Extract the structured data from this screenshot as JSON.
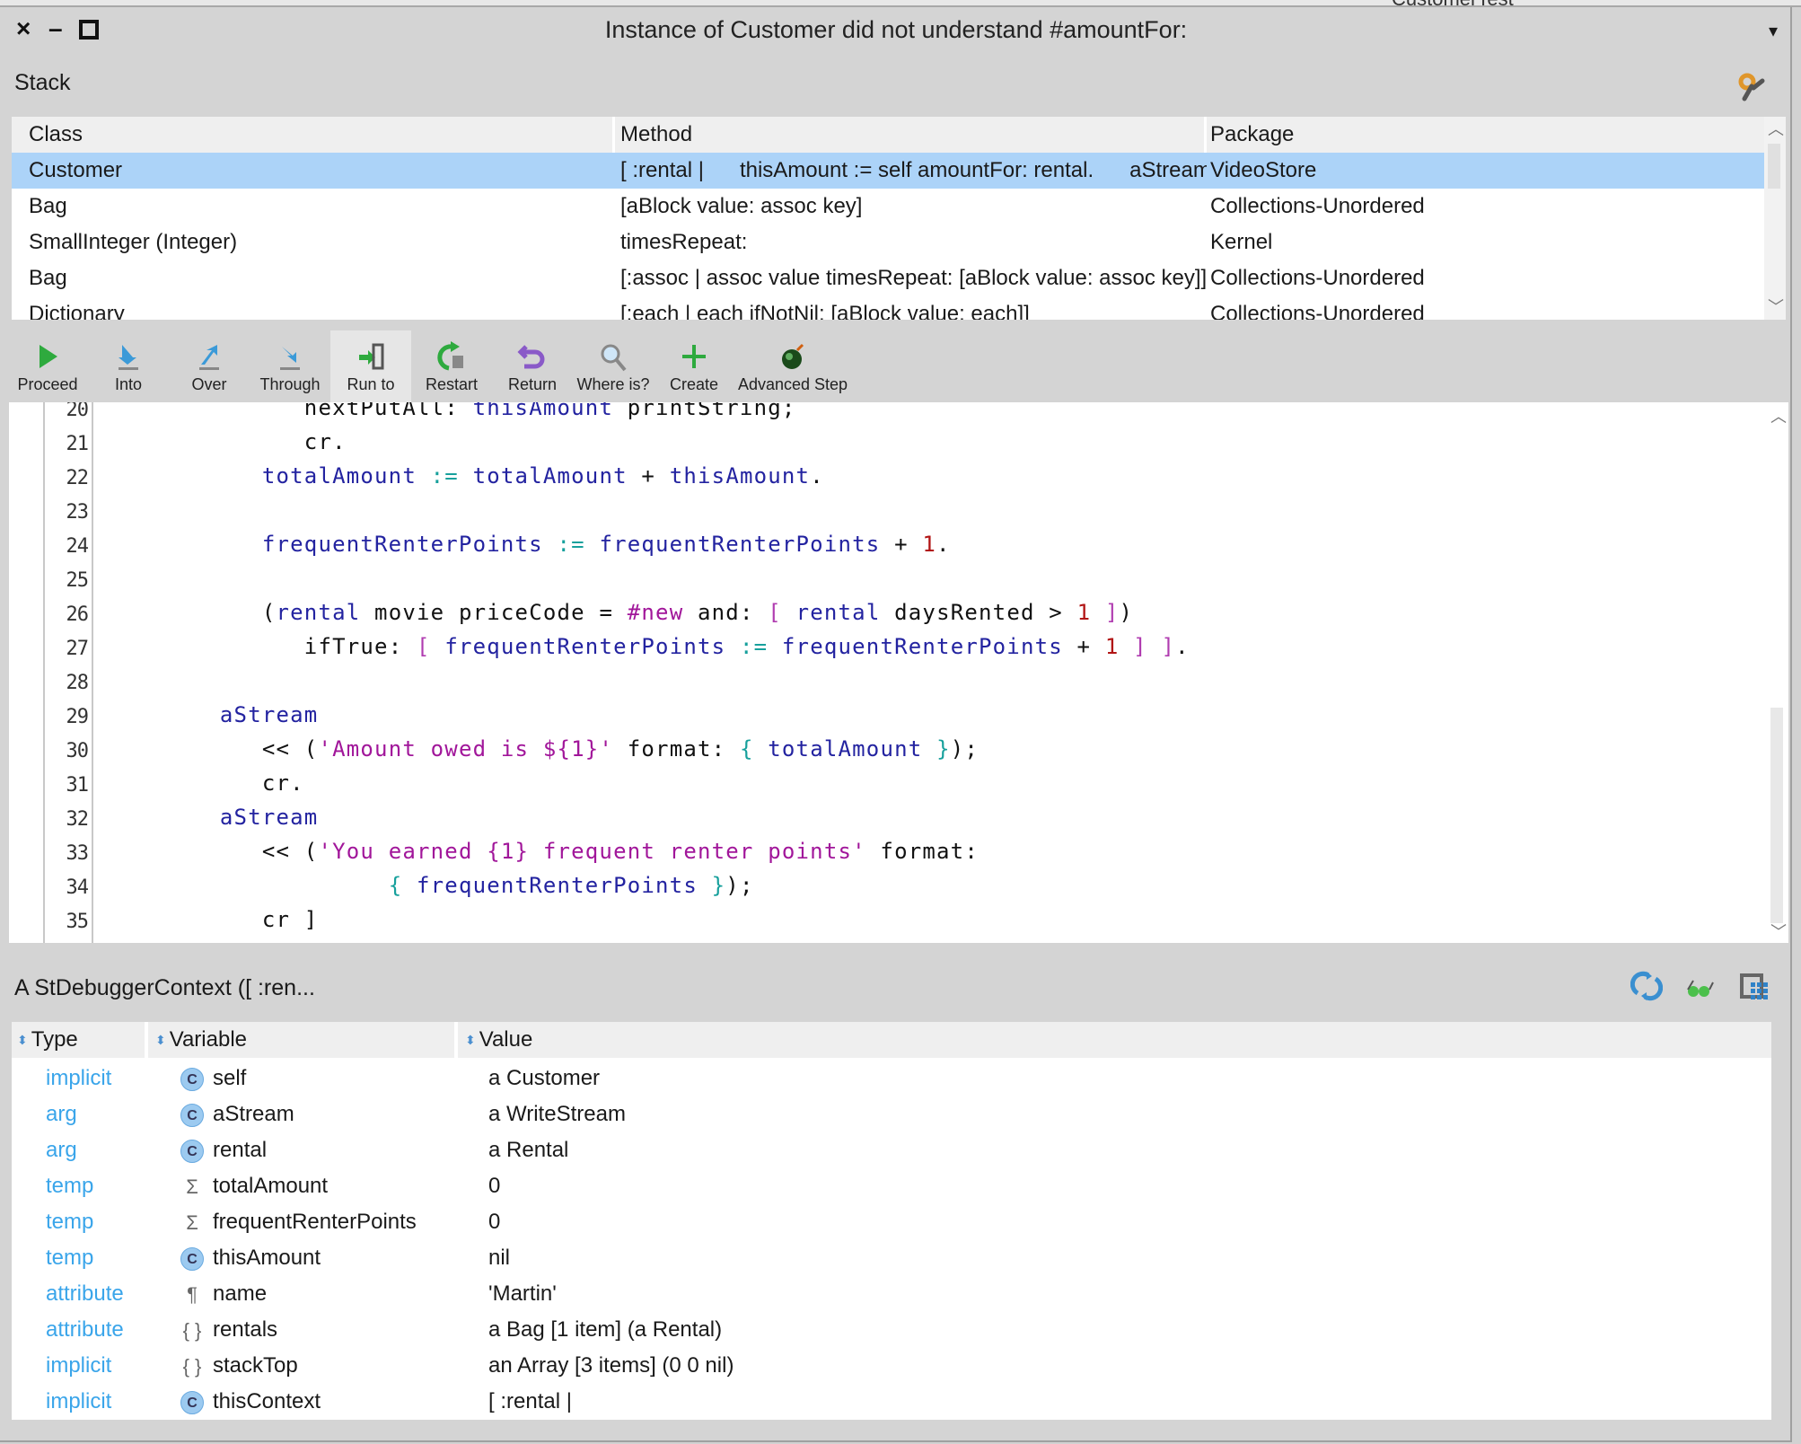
{
  "background_window": {
    "title_fragment": "CustomerTest"
  },
  "window": {
    "title": "Instance of Customer did not understand #amountFor:",
    "close": "×",
    "minimize": "–",
    "maximize": "□",
    "menu": "▾"
  },
  "stack": {
    "label": "Stack",
    "columns": [
      "Class",
      "Method",
      "Package"
    ],
    "rows": [
      {
        "class": "Customer",
        "method": "[ :rental |      thisAmount := self amountFor: rental.      aStream",
        "package": "VideoStore",
        "selected": true
      },
      {
        "class": "Bag",
        "method": "[aBlock value: assoc key]",
        "package": "Collections-Unordered"
      },
      {
        "class": "SmallInteger (Integer)",
        "method": "timesRepeat:",
        "package": "Kernel"
      },
      {
        "class": "Bag",
        "method": "[:assoc | assoc value timesRepeat: [aBlock value: assoc key]]",
        "package": "Collections-Unordered"
      },
      {
        "class": "Dictionary",
        "method": "[:each | each ifNotNil: [aBlock value: each]]",
        "package": "Collections-Unordered"
      }
    ]
  },
  "toolbar": [
    {
      "label": "Proceed",
      "icon": "play-icon"
    },
    {
      "label": "Into",
      "icon": "step-into-icon"
    },
    {
      "label": "Over",
      "icon": "step-over-icon"
    },
    {
      "label": "Through",
      "icon": "step-through-icon"
    },
    {
      "label": "Run to",
      "icon": "run-to-icon",
      "active": true
    },
    {
      "label": "Restart",
      "icon": "restart-icon"
    },
    {
      "label": "Return",
      "icon": "return-icon"
    },
    {
      "label": "Where is?",
      "icon": "magnifier-icon"
    },
    {
      "label": "Create",
      "icon": "plus-icon"
    },
    {
      "label": "Advanced Step",
      "icon": "bomb-icon"
    }
  ],
  "code": {
    "first_line": 20,
    "lines": [
      [
        [
          " ",
          "            "
        ],
        [
          "",
          "nextPutAll: "
        ],
        [
          "var",
          "thisAmount"
        ],
        [
          "",
          " printString;"
        ]
      ],
      [
        [
          " ",
          "            "
        ],
        [
          "",
          "cr."
        ]
      ],
      [
        [
          " ",
          "         "
        ],
        [
          "var",
          "totalAmount"
        ],
        [
          "tl",
          " :="
        ],
        [
          "",
          " "
        ],
        [
          "var",
          "totalAmount"
        ],
        [
          "",
          " + "
        ],
        [
          "var",
          "thisAmount"
        ],
        [
          "",
          "."
        ]
      ],
      [],
      [
        [
          " ",
          "         "
        ],
        [
          "var",
          "frequentRenterPoints"
        ],
        [
          "tl",
          " :="
        ],
        [
          "",
          " "
        ],
        [
          "var",
          "frequentRenterPoints"
        ],
        [
          "",
          " + "
        ],
        [
          "num",
          "1"
        ],
        [
          "",
          "."
        ]
      ],
      [],
      [
        [
          " ",
          "         "
        ],
        [
          "",
          "("
        ],
        [
          "var",
          "rental"
        ],
        [
          "",
          " movie priceCode = "
        ],
        [
          "sym",
          "#new"
        ],
        [
          "",
          " and: "
        ],
        [
          "br",
          "["
        ],
        [
          "",
          " "
        ],
        [
          "var",
          "rental"
        ],
        [
          "",
          " daysRented > "
        ],
        [
          "num",
          "1"
        ],
        [
          "",
          " "
        ],
        [
          "br",
          "]"
        ],
        [
          "",
          ")"
        ]
      ],
      [
        [
          " ",
          "            "
        ],
        [
          "",
          "ifTrue: "
        ],
        [
          "br",
          "["
        ],
        [
          "",
          " "
        ],
        [
          "var",
          "frequentRenterPoints"
        ],
        [
          "tl",
          " :="
        ],
        [
          "",
          " "
        ],
        [
          "var",
          "frequentRenterPoints"
        ],
        [
          "",
          " + "
        ],
        [
          "num",
          "1"
        ],
        [
          "",
          " "
        ],
        [
          "br",
          "]"
        ],
        [
          "",
          " "
        ],
        [
          "br",
          "]"
        ],
        [
          "",
          "."
        ]
      ],
      [],
      [
        [
          " ",
          "      "
        ],
        [
          "var",
          "aStream"
        ]
      ],
      [
        [
          " ",
          "         "
        ],
        [
          "",
          "<< ("
        ],
        [
          "str",
          "'Amount owed is ${1}'"
        ],
        [
          "",
          " format: "
        ],
        [
          "tl",
          "{"
        ],
        [
          "",
          " "
        ],
        [
          "var",
          "totalAmount"
        ],
        [
          "",
          " "
        ],
        [
          "tl",
          "}"
        ],
        [
          "",
          ");"
        ]
      ],
      [
        [
          " ",
          "         "
        ],
        [
          "",
          "cr."
        ]
      ],
      [
        [
          " ",
          "      "
        ],
        [
          "var",
          "aStream"
        ]
      ],
      [
        [
          " ",
          "         "
        ],
        [
          "",
          "<< ("
        ],
        [
          "str",
          "'You earned {1} frequent renter points'"
        ],
        [
          "",
          " format:"
        ]
      ],
      [
        [
          " ",
          "                  "
        ],
        [
          "tl",
          "{"
        ],
        [
          "",
          " "
        ],
        [
          "var",
          "frequentRenterPoints"
        ],
        [
          "",
          " "
        ],
        [
          "tl",
          "}"
        ],
        [
          "",
          ");"
        ]
      ],
      [
        [
          " ",
          "         "
        ],
        [
          "",
          "cr ]"
        ]
      ]
    ]
  },
  "inspector": {
    "label": "A StDebuggerContext ([ :ren...",
    "columns": [
      "Type",
      "Variable",
      "Value"
    ],
    "header_icons": [
      "refresh-icon",
      "glasses-icon",
      "grid-icon"
    ],
    "rows": [
      {
        "type": "implicit",
        "icon": "C",
        "var": "self",
        "value": "a Customer"
      },
      {
        "type": "arg",
        "icon": "C",
        "var": "aStream",
        "value": "a WriteStream"
      },
      {
        "type": "arg",
        "icon": "C",
        "var": "rental",
        "value": "a Rental"
      },
      {
        "type": "temp",
        "icon": "Σ",
        "var": "totalAmount",
        "value": "0"
      },
      {
        "type": "temp",
        "icon": "Σ",
        "var": "frequentRenterPoints",
        "value": "0"
      },
      {
        "type": "temp",
        "icon": "C",
        "var": "thisAmount",
        "value": "nil"
      },
      {
        "type": "attribute",
        "icon": "¶",
        "var": "name",
        "value": "'Martin'"
      },
      {
        "type": "attribute",
        "icon": "{ }",
        "var": "rentals",
        "value": "a Bag [1 item] (a Rental)"
      },
      {
        "type": "implicit",
        "icon": "{ }",
        "var": "stackTop",
        "value": "an Array [3 items] (0 0 nil)"
      },
      {
        "type": "implicit",
        "icon": "C",
        "var": "thisContext",
        "value": "[ :rental |"
      }
    ]
  },
  "colors": {
    "selection": "#acd3f8",
    "type_text": "#3aa5ea",
    "code_variable": "#2323a0",
    "code_string": "#a1169a",
    "code_number": "#b11414"
  }
}
